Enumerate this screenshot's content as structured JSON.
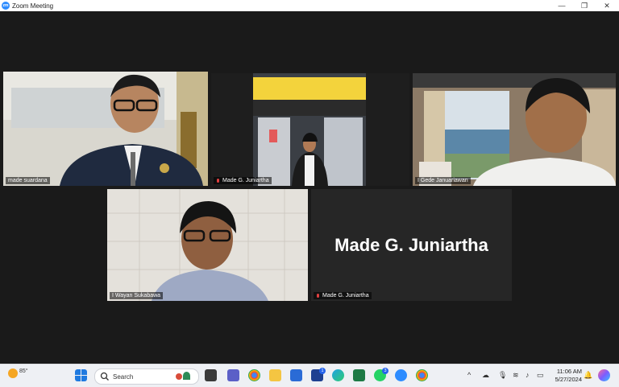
{
  "window": {
    "title": "Zoom Meeting",
    "logo_text": "zm",
    "minimize": "—",
    "restore": "❐",
    "close": "✕"
  },
  "participants": [
    {
      "name": "made suardana",
      "muted": false,
      "active_speaker": true
    },
    {
      "name": "Made G. Juniartha",
      "muted": true,
      "active_speaker": false
    },
    {
      "name": "I Gede Januariawan",
      "muted": false,
      "active_speaker": false
    },
    {
      "name": "I Wayan Sukabawa",
      "muted": false,
      "active_speaker": false
    },
    {
      "name": "Made G. Juniartha",
      "muted": true,
      "active_speaker": false,
      "video_off": true,
      "display_text": "Made G. Juniartha"
    }
  ],
  "taskbar": {
    "weather": "85°",
    "search_placeholder": "Search",
    "whatsapp_badge": "3",
    "l_badge": "1",
    "time": "11:06 AM",
    "date": "5/27/2024"
  },
  "colors": {
    "active_speaker_border": "#b6e64a",
    "zoom_blue": "#2d8cff",
    "muted_red": "#e04040"
  }
}
